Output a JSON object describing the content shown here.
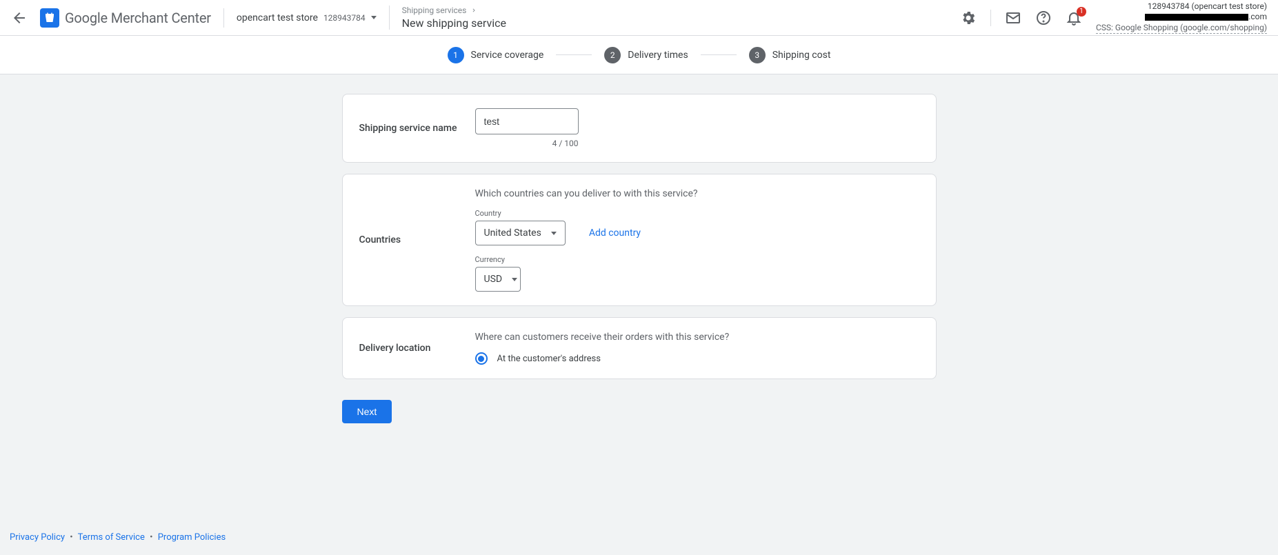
{
  "header": {
    "app_name": "Google Merchant Center",
    "store_name": "opencart test store",
    "store_id": "128943784",
    "breadcrumb_parent": "Shipping services",
    "page_title": "New shipping service",
    "notification_count": "1",
    "account_line1": "128943784 (opencart test store)",
    "account_line2_suffix": ".com",
    "css_line": "CSS: Google Shopping (google.com/shopping)"
  },
  "stepper": {
    "step1": {
      "num": "1",
      "label": "Service coverage"
    },
    "step2": {
      "num": "2",
      "label": "Delivery times"
    },
    "step3": {
      "num": "3",
      "label": "Shipping cost"
    }
  },
  "form": {
    "shipping_service_name": {
      "label": "Shipping service name",
      "value": "test",
      "counter": "4 / 100"
    },
    "countries": {
      "label": "Countries",
      "question": "Which countries can you deliver to with this service?",
      "country_label": "Country",
      "selected_country": "United States",
      "add_country": "Add country",
      "currency_label": "Currency",
      "selected_currency": "USD"
    },
    "delivery_location": {
      "label": "Delivery location",
      "question": "Where can customers receive their orders with this service?",
      "option_address": "At the customer's address"
    },
    "next_button": "Next"
  },
  "footer": {
    "privacy": "Privacy Policy",
    "terms": "Terms of Service",
    "program": "Program Policies"
  }
}
